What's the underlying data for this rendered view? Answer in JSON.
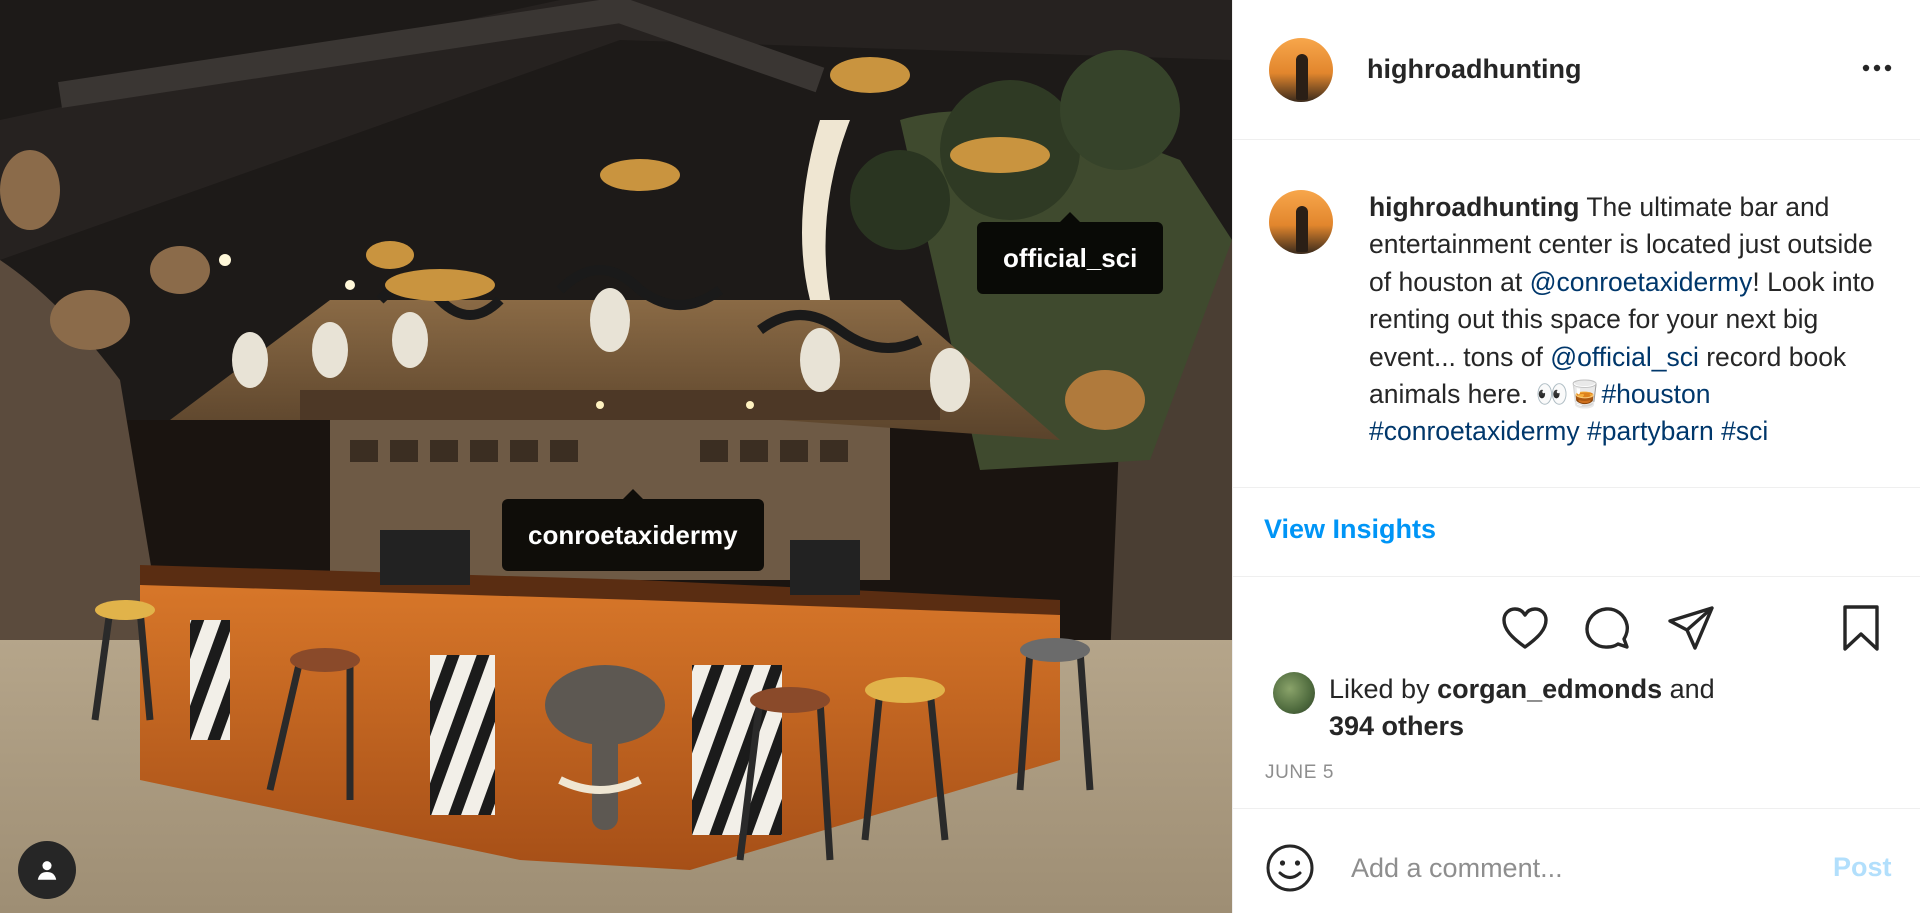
{
  "post": {
    "author": "highroadhunting",
    "photo": {
      "tags": [
        {
          "label": "official_sci"
        },
        {
          "label": "conroetaxidermy"
        }
      ]
    },
    "caption": {
      "username": "highroadhunting",
      "text_part1": " The ultimate bar and entertainment center is located just outside of houston at ",
      "mention1": "@conroetaxidermy",
      "text_part2": "! Look into renting out this space for your next big event... tons of ",
      "mention2": "@official_sci",
      "text_part3": " record book animals here. 👀🥃",
      "hashtag1": "#houston",
      "hashtag2": "#conroetaxidermy",
      "hashtag3": "#partybarn",
      "hashtag4": "#sci"
    },
    "insights_label": "View Insights",
    "likes": {
      "prefix": "Liked by ",
      "user": "corgan_edmonds",
      "suffix": " and",
      "others": "394 others"
    },
    "date": "JUNE 5",
    "comment": {
      "placeholder": "Add a comment...",
      "post_label": "Post"
    },
    "icons": {
      "more": "more-horizontal-icon",
      "like": "heart-icon",
      "comment": "comment-icon",
      "share": "paper-plane-icon",
      "save": "bookmark-icon",
      "emoji": "smiley-icon",
      "user_tags": "person-icon"
    },
    "colors": {
      "link": "#00376b",
      "accent": "#0095f6",
      "post_disabled": "#b2dffc",
      "muted": "#8e8e8e"
    }
  }
}
